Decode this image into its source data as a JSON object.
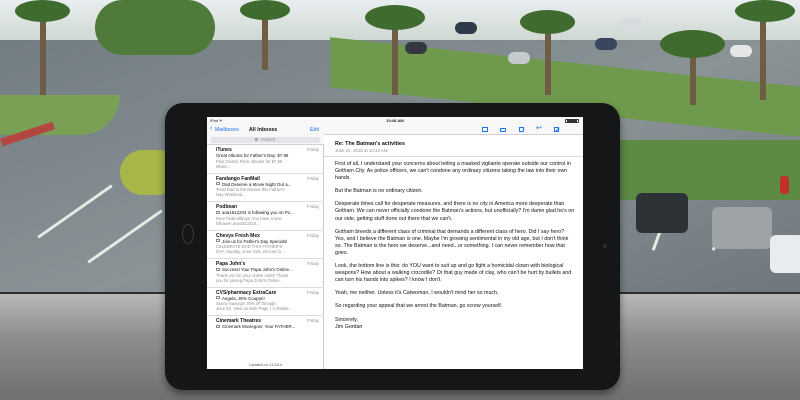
{
  "status_bar": {
    "carrier": "iPad ✈︎",
    "time": "10:08 AM"
  },
  "mailboxes": {
    "back_label": "Mailboxes",
    "title": "All Inboxes",
    "edit_label": "Edit",
    "search_placeholder": "Search",
    "footer": "Updated on 11/4/14"
  },
  "messages": [
    {
      "sender": "iTunes",
      "day": "Friday",
      "subject": "Great Albums for Father's Day: $7.99",
      "preview": [
        "Plus Classic Rock Albums for $7.99",
        "Music..."
      ]
    },
    {
      "sender": "Fandango FanMail",
      "day": "Friday",
      "subject": "Dad Deserve a Movie Night Out a...",
      "preview": [
        "Treat Dad to the Movies this Father's",
        "Day Weekend..."
      ]
    },
    {
      "sender": "Podbean",
      "day": "Friday",
      "subject": "ana1612234 is following you on Po...",
      "preview": [
        "Dear hintendiboys, You have a new",
        "follower! ana1612234..."
      ]
    },
    {
      "sender": "Chevys Fresh Mex",
      "day": "Friday",
      "subject": "Join us for Father's Day Specials!",
      "preview": [
        "CELEBRATE DAD THIS FATHER'S",
        "DAY, Sunday, June 21st, we love D..."
      ]
    },
    {
      "sender": "Papa John's",
      "day": "Friday",
      "subject": "Success! Your Papa John's Online...",
      "preview": [
        "Thank you for your online order! Thank",
        "you for joining Papa John's Online..."
      ]
    },
    {
      "sender": "CVS/pharmacy ExtraCare",
      "day": "Friday",
      "subject": "Angela, 30% Coupon!",
      "preview": [
        "Sunny Savings! 30% off through",
        "June 22, View as Web Page | +] Relate..."
      ]
    },
    {
      "sender": "Cinemark Theatres",
      "day": "Friday",
      "subject": "Cinemark Moviegoer, Your FATHER...",
      "preview": [
        "",
        ""
      ]
    }
  ],
  "reader": {
    "subject": "Re: The Batman's activities",
    "date": "June 22, 2015 at 10:33 AM",
    "paragraphs": [
      "First of all, I understand your concerns about letting a masked vigilante operate outside our control in Gotham City. As police officers, we can't condone any ordinary citizens taking the law into their own hands.",
      "But the Batman is no ordinary citizen.",
      "Desperate times call for desperate measures, and there is no city in America more desperate than Gotham. We can never officially condone the Batman's actions, but unofficially? I'm damn glad he's on our side, getting stuff done out there that we can't.",
      "Gotham breeds a different class of criminal that demands a different class of hero. Did I say hero? Yes, and I believe the Batman is one. Maybe I'm growing sentimental in my old age, but I don't think so. The Batman is the hero we deserve...and need...or something. I can never remember how that goes.",
      "Look, the bottom line is this: do YOU want to suit up and go fight a homicidal clown with biological weapons? How about a walking crocodile? Or that guy made of clay, who can't be hurt by bullets and can turn his hands into spikes? I know I don't.",
      "Yeah, me neither. Unless it's Catwoman, I wouldn't mind her so much.",
      "So regarding your appeal that we arrest the Batman, go screw yourself."
    ],
    "signoff": "Sincerely,",
    "signature": "Jim Gordan"
  },
  "icons": [
    "back-chevron-icon",
    "search-icon",
    "flag-icon",
    "folder-icon",
    "trash-icon",
    "reply-icon",
    "compose-icon",
    "home-button-icon"
  ],
  "colors": {
    "ios_blue": "#1a73e8",
    "ipad_bezel": "#141618",
    "secondary_text": "#8e8e93"
  }
}
